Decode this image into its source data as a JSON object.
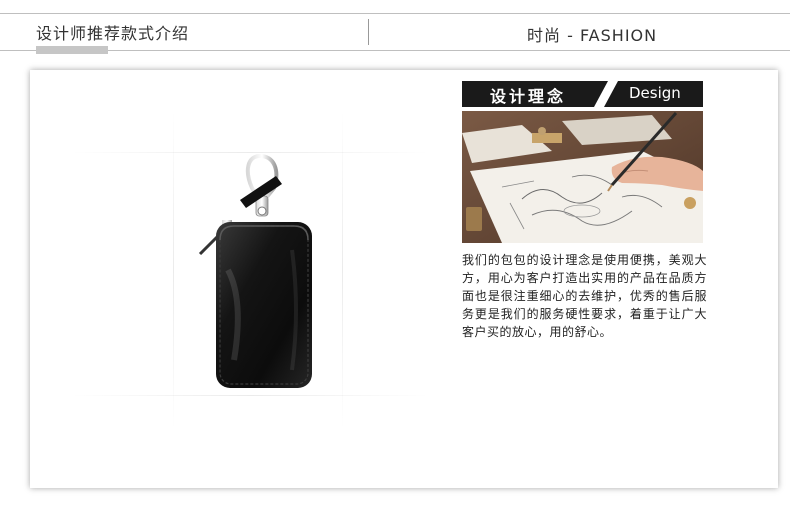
{
  "header": {
    "left_title": "设计师推荐款式介绍",
    "right_title": "时尚 - FASHION"
  },
  "design_section": {
    "label_cn": "设计理念",
    "label_en": "Design",
    "description": "我们的包包的设计理念是使用便携，美观大方，用心为客户打造出实用的产品在品质方面也是很注重细心的去维护，优秀的售后服务更是我们的服务硬性要求，着重于让广大客户买的放心，用的舒心。"
  },
  "product": {
    "icon": "leather-key-case"
  },
  "photo": {
    "icon": "designer-sketching-photo"
  },
  "colors": {
    "header_rule": "#bfbfbf",
    "accent_bar": "#c6c6c6",
    "banner_black": "#1a1a1a",
    "leather": "#141414"
  }
}
